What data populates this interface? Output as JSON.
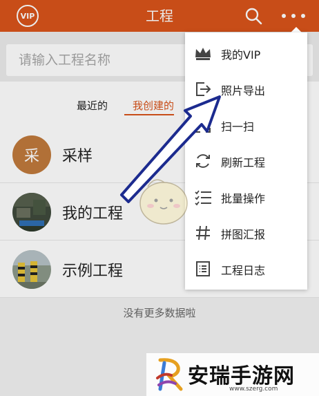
{
  "header": {
    "vip_badge": "VIP",
    "title": "工程",
    "color": "#d9541b"
  },
  "search": {
    "placeholder": "请输入工程名称"
  },
  "tabs": [
    {
      "label": "最近的"
    },
    {
      "label": "我创建的",
      "active": true
    }
  ],
  "projects": [
    {
      "name": "采样",
      "avatar_text": "采"
    },
    {
      "name": "我的工程"
    },
    {
      "name": "示例工程"
    }
  ],
  "list_footer": "没有更多数据啦",
  "menu": {
    "items": [
      {
        "label": "我的VIP",
        "icon": "crown-icon"
      },
      {
        "label": "照片导出",
        "icon": "export-icon"
      },
      {
        "label": "扫一扫",
        "icon": "scan-icon"
      },
      {
        "label": "刷新工程",
        "icon": "refresh-icon"
      },
      {
        "label": "批量操作",
        "icon": "checklist-icon"
      },
      {
        "label": "拼图汇报",
        "icon": "grid-icon"
      },
      {
        "label": "工程日志",
        "icon": "log-icon"
      }
    ]
  },
  "watermark": {
    "text": "安瑞手游网",
    "url": "www.szerg.com"
  }
}
